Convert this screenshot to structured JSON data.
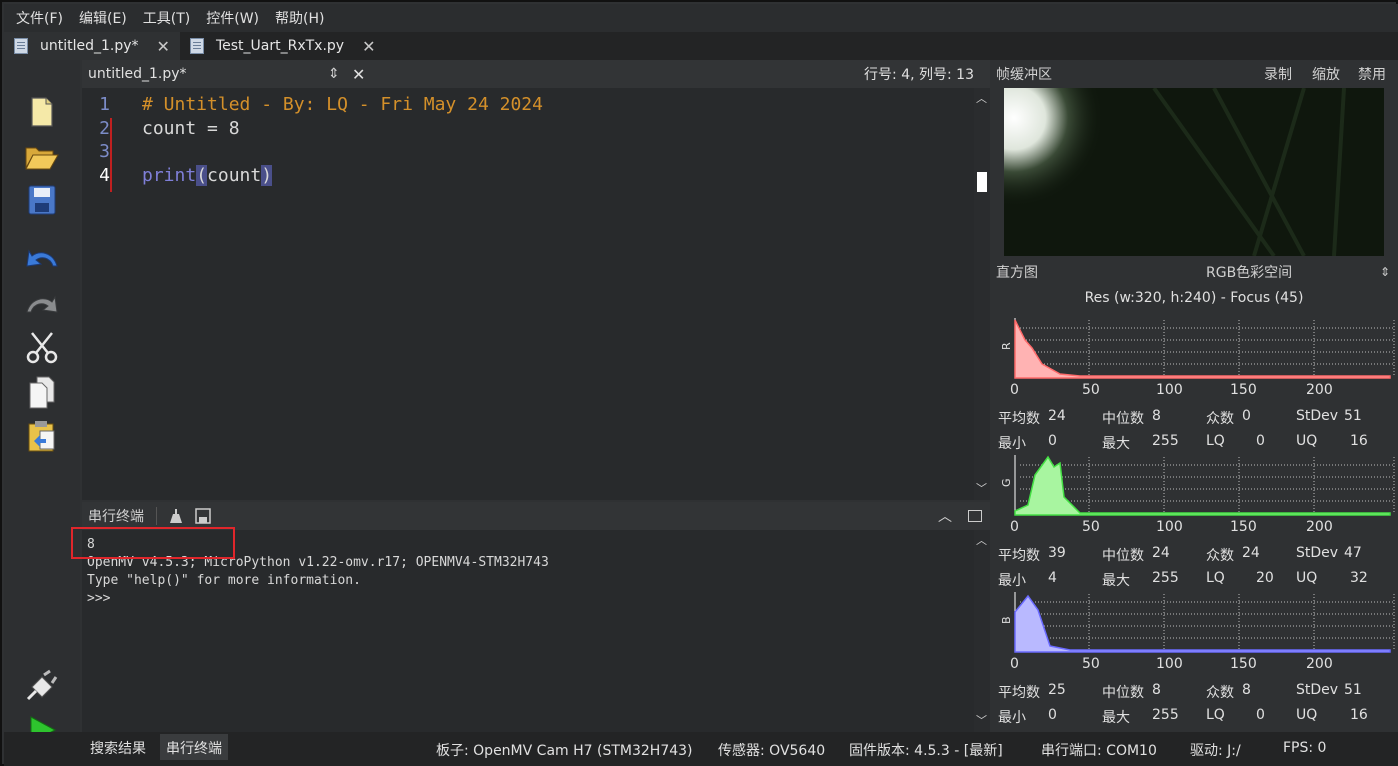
{
  "menu": [
    "文件(F)",
    "编辑(E)",
    "工具(T)",
    "控件(W)",
    "帮助(H)"
  ],
  "file_tabs": [
    {
      "label": "untitled_1.py*"
    },
    {
      "label": "Test_Uart_RxTx.py"
    }
  ],
  "editor": {
    "filename": "untitled_1.py*",
    "cursor_pos": "行号: 4, 列号: 13",
    "lines": [
      {
        "num": "1",
        "code": "# Untitled - By: LQ - Fri May 24 2024"
      },
      {
        "num": "2",
        "code": "count = 8"
      },
      {
        "num": "3",
        "code": ""
      },
      {
        "num": "4",
        "code_fn": "print",
        "code_paren_open": "(",
        "code_arg": "count",
        "code_paren_close": ")"
      }
    ]
  },
  "terminal": {
    "title": "串行终端",
    "lines": [
      "8",
      "OpenMV v4.5.3; MicroPython v1.22-omv.r17; OPENMV4-STM32H743",
      "Type \"help()\" for more information.",
      ">>>"
    ]
  },
  "framebuffer": {
    "title": "帧缓冲区",
    "actions": [
      "录制",
      "缩放",
      "禁用"
    ]
  },
  "histogram": {
    "title": "直方图",
    "colorspace": "RGB色彩空间",
    "resolution": "Res (w:320, h:240) - Focus (45)",
    "ticks": [
      "0",
      "50",
      "100",
      "150",
      "200"
    ],
    "labels": {
      "mean": "平均数",
      "median": "中位数",
      "mode": "众数",
      "stdev": "StDev",
      "min": "最小",
      "max": "最大",
      "lq": "LQ",
      "uq": "UQ"
    },
    "channels": [
      {
        "name": "R",
        "color": "#ffb3b3",
        "line": "#ff6a6a",
        "mean": "24",
        "median": "8",
        "mode": "0",
        "stdev": "51",
        "min": "0",
        "max": "255",
        "lq": "0",
        "uq": "16"
      },
      {
        "name": "G",
        "color": "#a8f5a0",
        "line": "#44e044",
        "mean": "39",
        "median": "24",
        "mode": "24",
        "stdev": "47",
        "min": "4",
        "max": "255",
        "lq": "20",
        "uq": "32"
      },
      {
        "name": "B",
        "color": "#b9b9ff",
        "line": "#6a6aff",
        "mean": "25",
        "median": "8",
        "mode": "8",
        "stdev": "51",
        "min": "0",
        "max": "255",
        "lq": "0",
        "uq": "16"
      }
    ]
  },
  "bottom_tabs": [
    "搜索结果",
    "串行终端"
  ],
  "status": {
    "board": "板子: OpenMV Cam H7 (STM32H743)",
    "sensor": "传感器: OV5640",
    "firmware": "固件版本: 4.5.3 - [最新]",
    "port": "串行端口: COM10",
    "drive": "驱动: J:/",
    "fps": "FPS: 0"
  },
  "colors": {
    "comment": "#d4902a",
    "keyword": "#7f7fd8",
    "paren_bg": "#4a4f8a",
    "highlight_box": "#e0262b"
  }
}
